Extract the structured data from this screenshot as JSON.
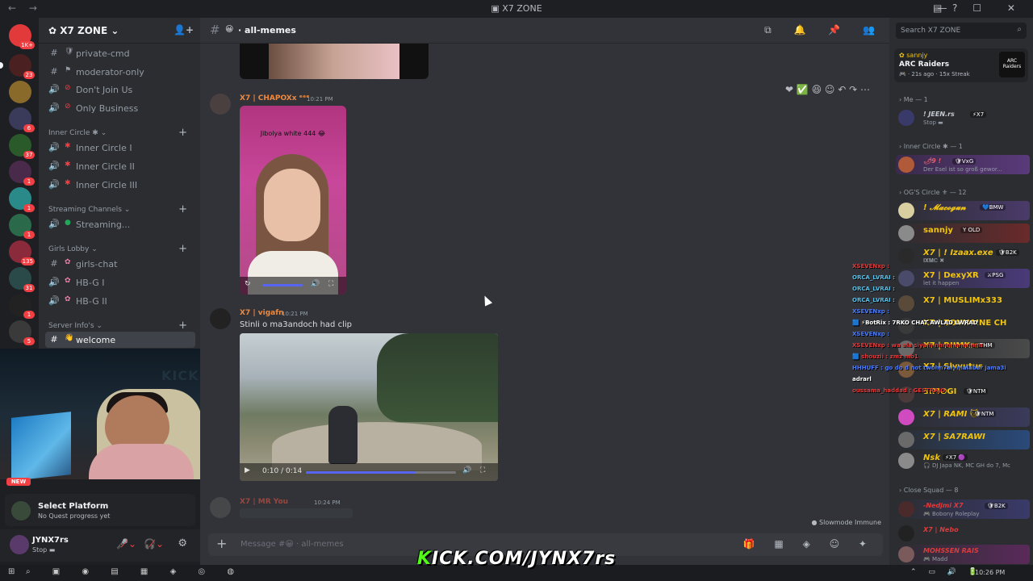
{
  "window": {
    "title": "X7 ZONE",
    "nav": "← →"
  },
  "servers": [
    {
      "badge": "1K+"
    },
    {
      "badge": "23"
    },
    {
      "badge": ""
    },
    {
      "badge": "6"
    },
    {
      "badge": "37"
    },
    {
      "badge": "1"
    },
    {
      "badge": "1"
    },
    {
      "badge": "1"
    },
    {
      "badge": "135"
    },
    {
      "badge": "31"
    },
    {
      "badge": "1"
    },
    {
      "badge": "5"
    }
  ],
  "guild": {
    "name": "X7 ZONE",
    "chevron": "⌄"
  },
  "channels": {
    "top": [
      {
        "icon": "#",
        "emoji": "🛡",
        "label": "private-cmd"
      },
      {
        "icon": "#",
        "emoji": "⚑",
        "label": "moderator-only"
      },
      {
        "icon": "🔊",
        "emoji": "⊘",
        "label": "Don't Join Us"
      },
      {
        "icon": "🔊",
        "emoji": "⊘",
        "label": "Only Business"
      }
    ],
    "inner_circle": {
      "label": "Inner Circle ✱ ⌄",
      "items": [
        {
          "icon": "🔊",
          "emoji": "✱",
          "label": "Inner Circle I"
        },
        {
          "icon": "🔊",
          "emoji": "✱",
          "label": "Inner Circle II"
        },
        {
          "icon": "🔊",
          "emoji": "✱",
          "label": "Inner Circle III"
        }
      ]
    },
    "streaming": {
      "label": "Streaming Channels ⌄",
      "items": [
        {
          "icon": "🔊",
          "emoji": "●",
          "label": "Streaming..."
        }
      ]
    },
    "girls": {
      "label": "Girls Lobby ⌄",
      "items": [
        {
          "icon": "#",
          "emoji": "✿",
          "label": "girls-chat"
        },
        {
          "icon": "🔊",
          "emoji": "✿",
          "label": "HB-G I"
        },
        {
          "icon": "🔊",
          "emoji": "✿",
          "label": "HB-G II"
        }
      ]
    },
    "server_info": {
      "label": "Server Info's ⌄",
      "items": [
        {
          "icon": "#",
          "emoji": "👋",
          "label": "welcome"
        }
      ]
    }
  },
  "webcam": {
    "new_badge": "NEW",
    "watermark": "KICK"
  },
  "quest": {
    "title": "Select Platform",
    "subtitle": "No Quest progress yet"
  },
  "user": {
    "name": "JYNX7rs",
    "status": "Stop ▬"
  },
  "chat": {
    "channel_emoji": "😀",
    "channel_name": "all-memes",
    "messages": [
      {
        "author": "X7 | CHAPOXx ᵉᵉᵉ",
        "time": "10:21 PM",
        "caption": "Jibolya white 444 😂",
        "color": "#f0883e"
      },
      {
        "author": "X7 | vigafn",
        "time": "10:21 PM",
        "text": "Stinli o ma3andoch had clip",
        "color": "#f0883e",
        "video_time": "0:10 / 0:14",
        "progress": 0.73
      },
      {
        "author": "X7 | MR You",
        "time": "10:24 PM",
        "color": "#c94f3f"
      }
    ],
    "hover_tools": "❤ ✅ 😆   ☺ ↶ ↷ ⋯",
    "input_placeholder": "Message #😀 · all-memes",
    "slowmode": "Slowmode Immune"
  },
  "members": {
    "search_placeholder": "Search X7 ZONE",
    "activity": {
      "user": "sannjy",
      "game": "ARC Raiders",
      "meta": "🎮 · 21s ago · 15x Streak",
      "art": "ARC Raiders"
    },
    "groups": [
      {
        "label": "› Me — 1",
        "members": [
          {
            "name": "! JEEN.rs",
            "tag": "⚡X7",
            "sub": "Stop ▬",
            "color": "#c5c9d0"
          }
        ]
      },
      {
        "label": "› Inner Circle ✱ — 1",
        "members": [
          {
            "name": "🌶9 !",
            "tag": "🛡VxG",
            "sub": "Der Esel ist so groß gewor...",
            "color": "#e05a6a"
          }
        ]
      },
      {
        "label": "› OG'S Circle ⚜ — 12",
        "members": [
          {
            "name": "! 𝓜𝓪𝓬𝓸𝓰𝓾𝓷",
            "tag": "💙BMW",
            "sub": "",
            "color": "#f1c40f"
          },
          {
            "name": "sannjy",
            "tag": "Y OLD",
            "sub": "",
            "color": "#f1c40f"
          },
          {
            "name": "X7 | ! Izaax.exe",
            "tag": "🛡B2K",
            "sub": "𝐈𝐗𝐌𝐂 ✖",
            "color": "#f1c40f"
          },
          {
            "name": "X7 | DexyXR",
            "tag": "⚔PSG",
            "sub": "let it happen",
            "color": "#f1c40f"
          },
          {
            "name": "X7 | MUSLIMx333",
            "tag": "",
            "sub": "",
            "color": "#f1c40f"
          },
          {
            "name": "X7 | ZOUHAINE CH",
            "tag": "",
            "sub": "",
            "color": "#f1c40f"
          },
          {
            "name": "X7 | RIIMKrs",
            "tag": "⚡THM",
            "sub": "",
            "color": "#f1c40f"
          },
          {
            "name": "X7 | Slyyutus",
            "tag": "",
            "sub": "",
            "color": "#f1c40f"
          },
          {
            "name": "SIMOGI",
            "tag": "🛡NTM",
            "sub": "",
            "color": "#f1c40f"
          },
          {
            "name": "X7 | RAMI 🐱",
            "tag": "🛡NTM",
            "sub": "",
            "color": "#f1c40f"
          },
          {
            "name": "X7 | SA7RAWI",
            "tag": "",
            "sub": "",
            "color": "#f1c40f"
          },
          {
            "name": "Nsk",
            "tag": "⚡X7 🟣",
            "sub": "🎧 DJ Japa NK, MC GH do 7, Mc",
            "color": "#f1c40f"
          }
        ]
      },
      {
        "label": "› Close Squad — 8",
        "members": [
          {
            "name": "-Nedjmi X7",
            "tag": "🛡B2K",
            "sub": "🎮 Bobony Roleplay",
            "color": "#e03a3a"
          },
          {
            "name": "X7 | Nebo",
            "tag": "",
            "sub": "",
            "color": "#e03a3a"
          },
          {
            "name": "MOHSSEN RAIS",
            "tag": "",
            "sub": "🎮 Madd",
            "color": "#e03a3a"
          }
        ]
      }
    ]
  },
  "overlay_chat": [
    {
      "text": "XSEVENxp :",
      "color": "#e23a3a"
    },
    {
      "text": "ORCA_LVRAI :",
      "color": "#57c1e8"
    },
    {
      "text": "ORCA_LVRAI :",
      "color": "#57c1e8"
    },
    {
      "text": "ORCA_LVRAI :",
      "color": "#57c1e8"
    },
    {
      "text": "XSEVENxp :",
      "color": "#4a7cff"
    },
    {
      "text": "🟦 ⚡BotRix : 7RKO CHAT AWLAD LWRAD",
      "color": "#ffffff"
    },
    {
      "text": "XSEVENxp :",
      "color": "#4a7cff"
    },
    {
      "text": "XSEVENxp : wa ala siyam nnnnnnnnnnnn",
      "color": "#e23a3a"
    },
    {
      "text": "🟦 shouzii : zmz mb1",
      "color": "#e23a3a"
    },
    {
      "text": "HHHUFF : go do d not twohn7ah malabar jama3i",
      "color": "#4a7cff"
    },
    {
      "text": "adrarl",
      "color": "#ffffff"
    },
    {
      "text": "oussama_haddad : GESTRAJO",
      "color": "#e23a3a"
    }
  ],
  "stream_overlay": {
    "prefix": "K",
    "text": "KICK.COM/JYNX7rs"
  },
  "taskbar": {
    "clock": "10:26 PM"
  },
  "colors": {
    "accent": "#5865f2",
    "kick_green": "#53fc18",
    "danger": "#f23f43"
  }
}
